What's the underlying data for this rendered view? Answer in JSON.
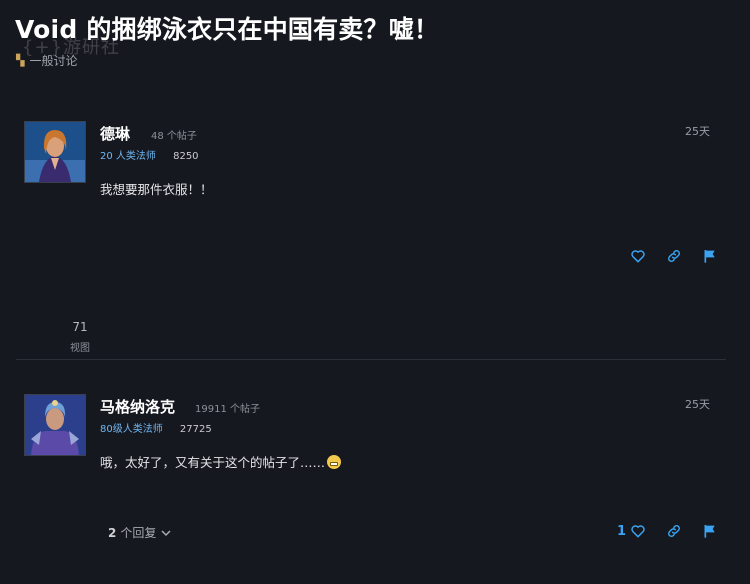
{
  "topic": {
    "title": "Void 的捆绑泳衣只在中国有卖？嘘！",
    "category": "一般讨论",
    "watermark": "{+}游研社"
  },
  "posts": [
    {
      "username": "德琳",
      "post_count": "48 个帖子",
      "character_class": "20 人类法师",
      "achievement_points": "8250",
      "age": "25天",
      "body": "我想要那件衣服！！"
    },
    {
      "username": "马格纳洛克",
      "post_count": "19911 个帖子",
      "character_class": "80级人类法师",
      "achievement_points": "27725",
      "age": "25天",
      "body": "哦，太好了，又有关于这个的帖子了……",
      "likes": "1",
      "replies_count": "2",
      "replies_label": "个回复"
    }
  ],
  "stats": {
    "views": "71",
    "views_label": "视图"
  },
  "colors": {
    "accent": "#3aa4f2",
    "class_color": "#6fb6f0",
    "background": "#16181f"
  },
  "icons": [
    "heart-icon",
    "link-icon",
    "flag-icon",
    "chevron-down-icon",
    "grimace-emoji"
  ]
}
